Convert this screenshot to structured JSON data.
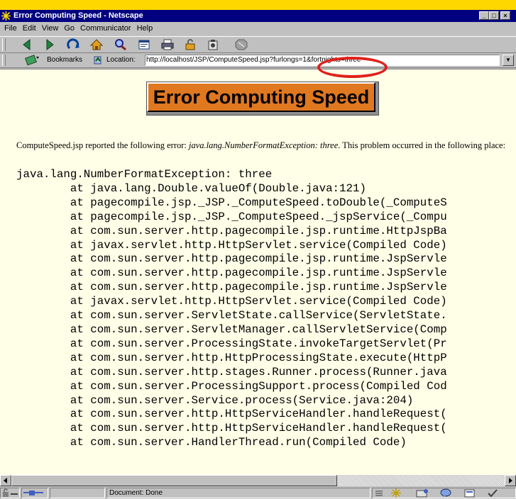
{
  "window": {
    "title": "Error Computing Speed - Netscape",
    "icon": "netscape-icon",
    "controls": [
      "minimize-icon",
      "maximize-icon",
      "close-icon"
    ]
  },
  "menu": [
    "File",
    "Edit",
    "View",
    "Go",
    "Communicator",
    "Help"
  ],
  "navigation_toolbar": {
    "buttons": [
      "back-icon",
      "forward-icon",
      "reload-icon",
      "home-icon",
      "search-icon",
      "my-netscape-icon",
      "print-icon",
      "security-icon",
      "shop-icon",
      "stop-icon"
    ]
  },
  "location_bar": {
    "bookmarks_label": "Bookmarks",
    "location_label": "Location:",
    "url_prefix": "http://localhost/JSP/ComputeSpeed.jsp?furlongs=",
    "url_highlight": "1&fortnights=three",
    "highlight_color": "#E0201A"
  },
  "page": {
    "heading": "Error Computing Speed",
    "heading_color": "#E07820",
    "message_before": "ComputeSpeed.jsp reported the following error: ",
    "message_error": "java.lang.NumberFormatException: three",
    "message_after": ". This problem occurred in the following place:",
    "stack_trace": [
      "java.lang.NumberFormatException: three",
      "        at java.lang.Double.valueOf(Double.java:121)",
      "        at pagecompile.jsp._JSP._ComputeSpeed.toDouble(_ComputeS",
      "        at pagecompile.jsp._JSP._ComputeSpeed._jspService(_Compu",
      "        at com.sun.server.http.pagecompile.jsp.runtime.HttpJspBa",
      "        at javax.servlet.http.HttpServlet.service(Compiled Code)",
      "        at com.sun.server.http.pagecompile.jsp.runtime.JspServle",
      "        at com.sun.server.http.pagecompile.jsp.runtime.JspServle",
      "        at com.sun.server.http.pagecompile.jsp.runtime.JspServle",
      "        at javax.servlet.http.HttpServlet.service(Compiled Code)",
      "        at com.sun.server.ServletState.callService(ServletState.",
      "        at com.sun.server.ServletManager.callServletService(Comp",
      "        at com.sun.server.ProcessingState.invokeTargetServlet(Pr",
      "        at com.sun.server.http.HttpProcessingState.execute(HttpP",
      "        at com.sun.server.http.stages.Runner.process(Runner.java",
      "        at com.sun.server.ProcessingSupport.process(Compiled Cod",
      "        at com.sun.server.Service.process(Service.java:204)",
      "        at com.sun.server.http.HttpServiceHandler.handleRequest(",
      "        at com.sun.server.http.HttpServiceHandler.handleRequest(",
      "        at com.sun.server.HandlerThread.run(Compiled Code)"
    ]
  },
  "status_bar": {
    "text": "Document: Done",
    "icons": [
      "security-lock-icon",
      "connection-icon",
      "component-bar-icon",
      "navigator-icon",
      "mail-icon",
      "discussion-icon",
      "composer-icon"
    ]
  }
}
